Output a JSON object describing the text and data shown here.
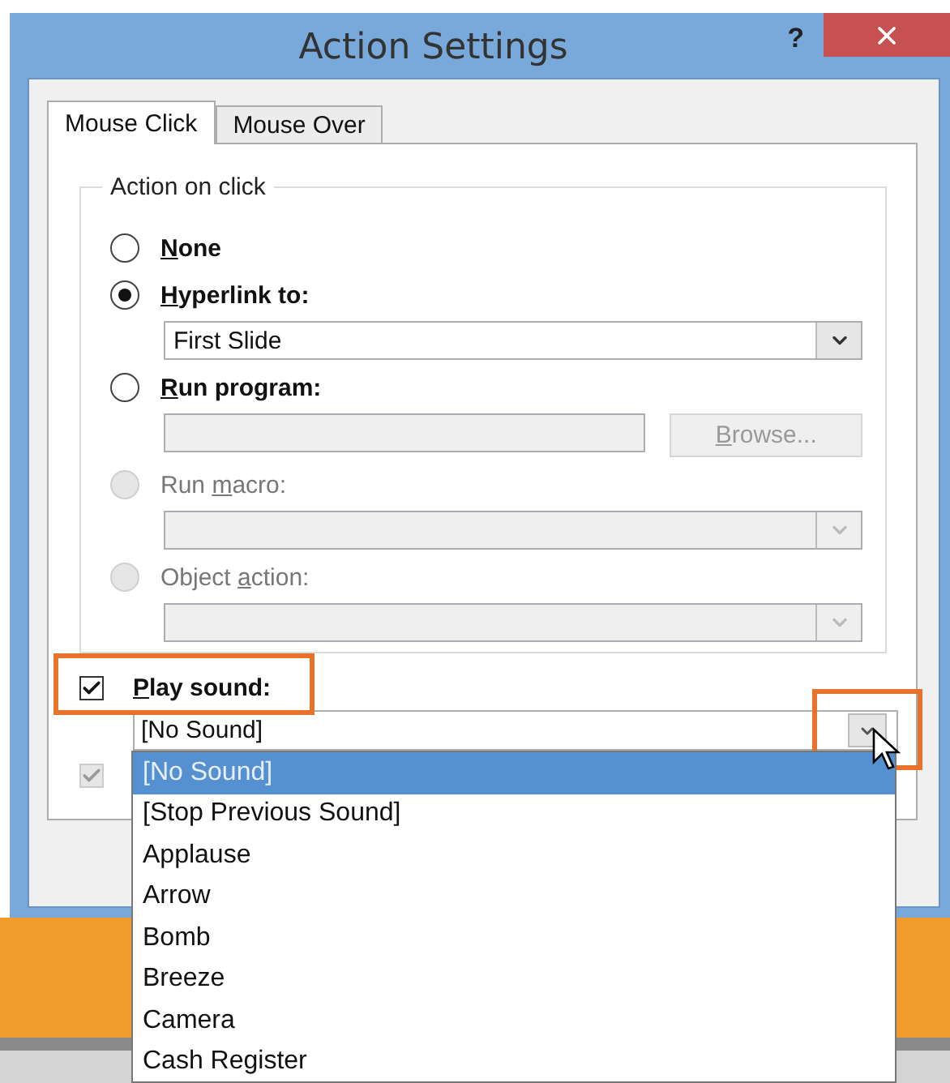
{
  "window": {
    "title": "Action Settings",
    "help": "?"
  },
  "tabs": [
    {
      "label": "Mouse Click",
      "selected": true
    },
    {
      "label": "Mouse Over",
      "selected": false
    }
  ],
  "group": {
    "title": "Action on click",
    "options": [
      {
        "label": {
          "key": "N",
          "post": "one"
        },
        "selected": false,
        "disabled": false
      },
      {
        "label": {
          "key": "H",
          "post": "yperlink to:"
        },
        "selected": true,
        "disabled": false,
        "control": {
          "kind": "combo",
          "value": "First Slide",
          "disabled": false
        }
      },
      {
        "label": {
          "key": "R",
          "post": "un program:"
        },
        "selected": false,
        "disabled": false,
        "control": {
          "kind": "browse",
          "button": {
            "key": "B",
            "post": "rowse..."
          },
          "disabled": true
        }
      },
      {
        "label": {
          "pre": "Run ",
          "key": "m",
          "post": "acro:"
        },
        "selected": false,
        "disabled": true,
        "control": {
          "kind": "combo",
          "disabled": true
        }
      },
      {
        "label": {
          "pre": "Object ",
          "key": "a",
          "post": "ction:"
        },
        "selected": false,
        "disabled": true,
        "control": {
          "kind": "combo",
          "disabled": true
        }
      }
    ]
  },
  "play_sound": {
    "label": {
      "key": "P",
      "post": "lay sound:"
    },
    "checked": true,
    "highlighted": true,
    "value": "[No Sound]",
    "arrow_highlighted": true
  },
  "second_checkbox": {
    "checked": true,
    "disabled": true
  },
  "sound_list": {
    "items": [
      {
        "label": "[No Sound]",
        "selected": true
      },
      {
        "label": "[Stop Previous Sound]",
        "selected": false
      },
      {
        "label": "Applause",
        "selected": false
      },
      {
        "label": "Arrow",
        "selected": false
      },
      {
        "label": "Bomb",
        "selected": false
      },
      {
        "label": "Breeze",
        "selected": false
      },
      {
        "label": "Camera",
        "selected": false
      },
      {
        "label": "Cash Register",
        "selected": false
      }
    ]
  }
}
